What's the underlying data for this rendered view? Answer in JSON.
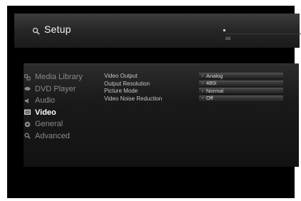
{
  "header": {
    "title": "Setup",
    "title_icon": "search-icon",
    "status_text": "All"
  },
  "sidebar": {
    "items": [
      {
        "label": "Media Library",
        "icon": "media-library-icon",
        "active": false
      },
      {
        "label": "DVD Player",
        "icon": "dvd-player-icon",
        "active": false
      },
      {
        "label": "Audio",
        "icon": "speaker-icon",
        "active": false
      },
      {
        "label": "Video",
        "icon": "screen-icon",
        "active": true
      },
      {
        "label": "General",
        "icon": "general-icon",
        "active": false
      },
      {
        "label": "Advanced",
        "icon": "advanced-search-icon",
        "active": false
      }
    ]
  },
  "settings": [
    {
      "label": "Video Output",
      "value": "Analog"
    },
    {
      "label": "Output Resolution",
      "value": "480i"
    },
    {
      "label": "Picture Mode",
      "value": "Normal"
    },
    {
      "label": "Video Noise Reduction",
      "value": "Off"
    }
  ],
  "colors": {
    "background": "#000000",
    "header": "#2a2a2a",
    "text_active": "#ffffff",
    "text_inactive": "#8a8a8a"
  }
}
